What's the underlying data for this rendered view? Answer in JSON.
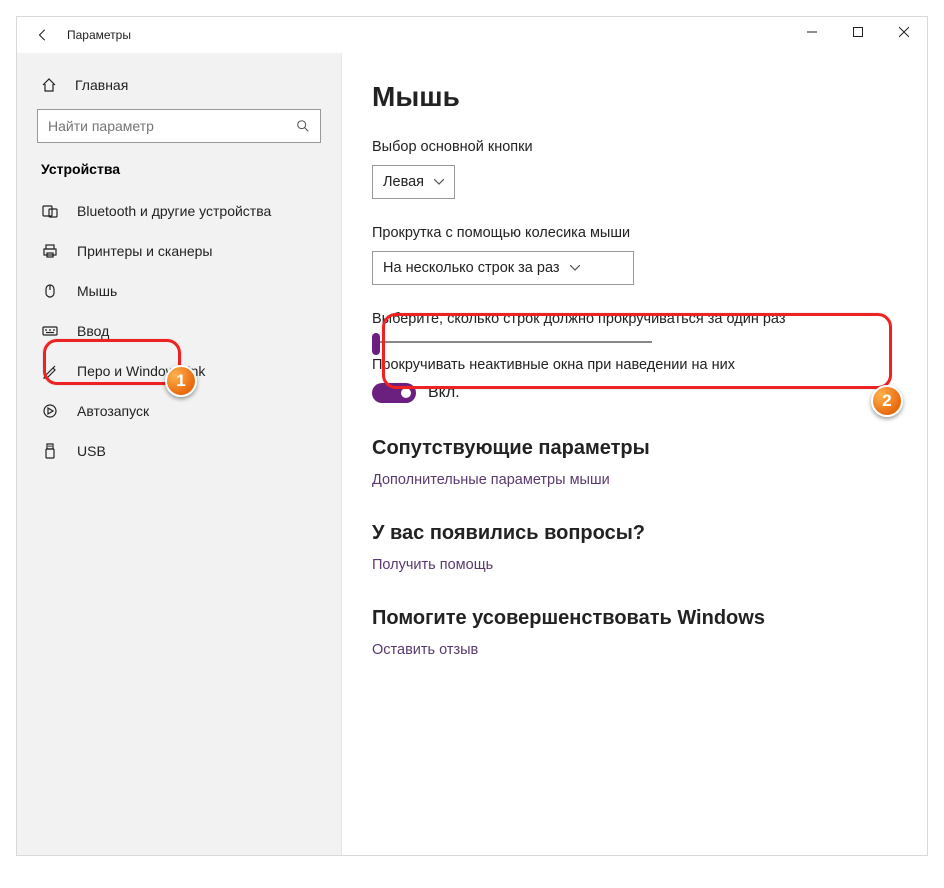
{
  "window": {
    "title": "Параметры"
  },
  "sidebar": {
    "home": "Главная",
    "search_placeholder": "Найти параметр",
    "category": "Устройства",
    "items": [
      {
        "label": "Bluetooth и другие устройства",
        "icon": "bluetooth-devices"
      },
      {
        "label": "Принтеры и сканеры",
        "icon": "printer"
      },
      {
        "label": "Мышь",
        "icon": "mouse"
      },
      {
        "label": "Ввод",
        "icon": "keyboard"
      },
      {
        "label": "Перо и Windows Ink",
        "icon": "pen"
      },
      {
        "label": "Автозапуск",
        "icon": "autoplay"
      },
      {
        "label": "USB",
        "icon": "usb"
      }
    ],
    "selected_index": 2
  },
  "main": {
    "title": "Мышь",
    "primary_button_label": "Выбор основной кнопки",
    "primary_button_value": "Левая",
    "scroll_mode_label": "Прокрутка с помощью колесика мыши",
    "scroll_mode_value": "На несколько строк за раз",
    "lines_label": "Выберите, сколько строк должно прокручиваться за один раз",
    "slider_value": 1,
    "inactive_label": "Прокручивать неактивные окна при наведении на них",
    "toggle_state": "Вкл.",
    "related_heading": "Сопутствующие параметры",
    "related_link": "Дополнительные параметры мыши",
    "help_heading": "У вас появились вопросы?",
    "help_link": "Получить помощь",
    "feedback_heading": "Помогите усовершенствовать Windows",
    "feedback_link": "Оставить отзыв"
  },
  "annotations": {
    "badge1": "1",
    "badge2": "2"
  }
}
